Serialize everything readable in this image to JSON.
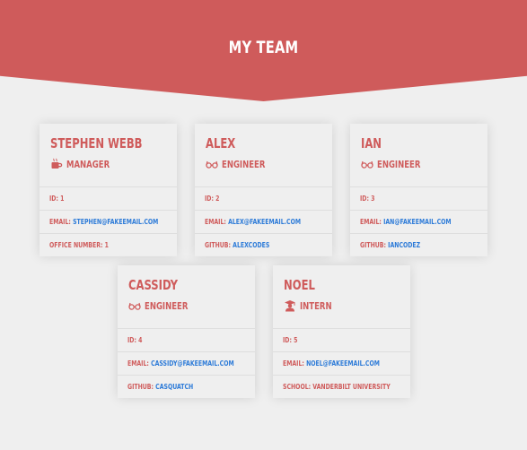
{
  "header": {
    "title": "MY TEAM"
  },
  "team": [
    {
      "name": "STEPHEN WEBB",
      "role": "MANAGER",
      "role_icon": "coffee-mug-icon",
      "id_label": "ID:",
      "id": "1",
      "email_label": "EMAIL:",
      "email": "STEPHEN@FAKEEMAIL.COM",
      "extra_label": "OFFICE NUMBER:",
      "extra": "1"
    },
    {
      "name": "ALEX",
      "role": "ENGINEER",
      "role_icon": "glasses-icon",
      "id_label": "ID:",
      "id": "2",
      "email_label": "EMAIL:",
      "email": "ALEX@FAKEEMAIL.COM",
      "extra_label": "GITHUB:",
      "extra": "ALEXCODES"
    },
    {
      "name": "IAN",
      "role": "ENGINEER",
      "role_icon": "glasses-icon",
      "id_label": "ID:",
      "id": "3",
      "email_label": "EMAIL:",
      "email": "IAN@FAKEEMAIL.COM",
      "extra_label": "GITHUB:",
      "extra": "IANCODEZ"
    },
    {
      "name": "CASSIDY",
      "role": "ENGINEER",
      "role_icon": "glasses-icon",
      "id_label": "ID:",
      "id": "4",
      "email_label": "EMAIL:",
      "email": "CASSIDY@FAKEEMAIL.COM",
      "extra_label": "GITHUB:",
      "extra": "CASQUATCH"
    },
    {
      "name": "NOEL",
      "role": "INTERN",
      "role_icon": "graduation-student-icon",
      "id_label": "ID:",
      "id": "5",
      "email_label": "EMAIL:",
      "email": "NOEL@FAKEEMAIL.COM",
      "extra_label": "SCHOOL:",
      "extra": "VANDERBILT UNIVERSITY"
    }
  ],
  "colors": {
    "accent": "#cf5b5b",
    "link": "#2d7bd8",
    "background": "#efefef"
  }
}
